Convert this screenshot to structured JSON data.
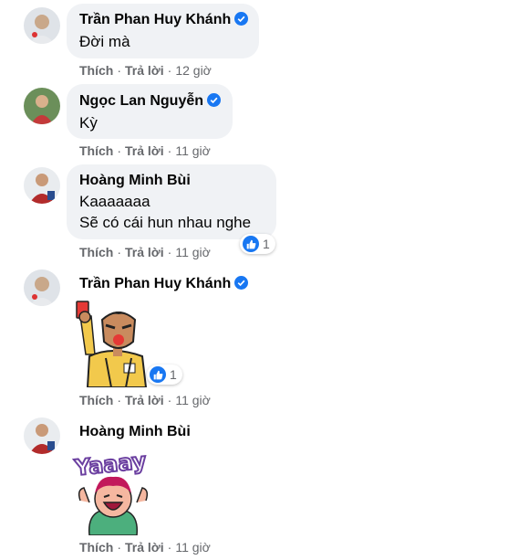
{
  "comments": [
    {
      "name": "Trần Phan Huy Khánh",
      "verified": true,
      "lines": [
        "Đời mà"
      ],
      "time": "12 giờ"
    },
    {
      "name": "Ngọc Lan Nguyễn",
      "verified": true,
      "lines": [
        "Kỳ"
      ],
      "time": "11 giờ"
    },
    {
      "name": "Hoàng Minh Bùi",
      "verified": false,
      "lines": [
        "Kaaaaaaa",
        "Sẽ có cái hun nhau nghe"
      ],
      "time": "11 giờ",
      "reactions": "1"
    },
    {
      "name": "Trần Phan Huy Khánh",
      "verified": true,
      "sticker": "referee-red-card-sticker",
      "time": "11 giờ",
      "reactions": "1"
    },
    {
      "name": "Hoàng Minh Bùi",
      "verified": false,
      "sticker": "yaaay-sticker",
      "sticker_text": "Yaaay",
      "time": "11 giờ"
    }
  ],
  "actions": {
    "like": "Thích",
    "reply": "Trả lời"
  },
  "colors": {
    "bubble": "#f0f2f5",
    "like_blue": "#1877f2",
    "meta": "#65676b"
  }
}
